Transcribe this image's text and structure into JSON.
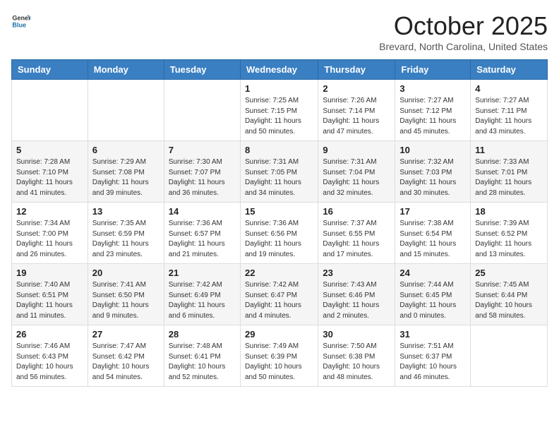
{
  "logo": {
    "general": "General",
    "blue": "Blue"
  },
  "title": "October 2025",
  "location": "Brevard, North Carolina, United States",
  "days_of_week": [
    "Sunday",
    "Monday",
    "Tuesday",
    "Wednesday",
    "Thursday",
    "Friday",
    "Saturday"
  ],
  "weeks": [
    [
      {
        "day": "",
        "info": ""
      },
      {
        "day": "",
        "info": ""
      },
      {
        "day": "",
        "info": ""
      },
      {
        "day": "1",
        "info": "Sunrise: 7:25 AM\nSunset: 7:15 PM\nDaylight: 11 hours\nand 50 minutes."
      },
      {
        "day": "2",
        "info": "Sunrise: 7:26 AM\nSunset: 7:14 PM\nDaylight: 11 hours\nand 47 minutes."
      },
      {
        "day": "3",
        "info": "Sunrise: 7:27 AM\nSunset: 7:12 PM\nDaylight: 11 hours\nand 45 minutes."
      },
      {
        "day": "4",
        "info": "Sunrise: 7:27 AM\nSunset: 7:11 PM\nDaylight: 11 hours\nand 43 minutes."
      }
    ],
    [
      {
        "day": "5",
        "info": "Sunrise: 7:28 AM\nSunset: 7:10 PM\nDaylight: 11 hours\nand 41 minutes."
      },
      {
        "day": "6",
        "info": "Sunrise: 7:29 AM\nSunset: 7:08 PM\nDaylight: 11 hours\nand 39 minutes."
      },
      {
        "day": "7",
        "info": "Sunrise: 7:30 AM\nSunset: 7:07 PM\nDaylight: 11 hours\nand 36 minutes."
      },
      {
        "day": "8",
        "info": "Sunrise: 7:31 AM\nSunset: 7:05 PM\nDaylight: 11 hours\nand 34 minutes."
      },
      {
        "day": "9",
        "info": "Sunrise: 7:31 AM\nSunset: 7:04 PM\nDaylight: 11 hours\nand 32 minutes."
      },
      {
        "day": "10",
        "info": "Sunrise: 7:32 AM\nSunset: 7:03 PM\nDaylight: 11 hours\nand 30 minutes."
      },
      {
        "day": "11",
        "info": "Sunrise: 7:33 AM\nSunset: 7:01 PM\nDaylight: 11 hours\nand 28 minutes."
      }
    ],
    [
      {
        "day": "12",
        "info": "Sunrise: 7:34 AM\nSunset: 7:00 PM\nDaylight: 11 hours\nand 26 minutes."
      },
      {
        "day": "13",
        "info": "Sunrise: 7:35 AM\nSunset: 6:59 PM\nDaylight: 11 hours\nand 23 minutes."
      },
      {
        "day": "14",
        "info": "Sunrise: 7:36 AM\nSunset: 6:57 PM\nDaylight: 11 hours\nand 21 minutes."
      },
      {
        "day": "15",
        "info": "Sunrise: 7:36 AM\nSunset: 6:56 PM\nDaylight: 11 hours\nand 19 minutes."
      },
      {
        "day": "16",
        "info": "Sunrise: 7:37 AM\nSunset: 6:55 PM\nDaylight: 11 hours\nand 17 minutes."
      },
      {
        "day": "17",
        "info": "Sunrise: 7:38 AM\nSunset: 6:54 PM\nDaylight: 11 hours\nand 15 minutes."
      },
      {
        "day": "18",
        "info": "Sunrise: 7:39 AM\nSunset: 6:52 PM\nDaylight: 11 hours\nand 13 minutes."
      }
    ],
    [
      {
        "day": "19",
        "info": "Sunrise: 7:40 AM\nSunset: 6:51 PM\nDaylight: 11 hours\nand 11 minutes."
      },
      {
        "day": "20",
        "info": "Sunrise: 7:41 AM\nSunset: 6:50 PM\nDaylight: 11 hours\nand 9 minutes."
      },
      {
        "day": "21",
        "info": "Sunrise: 7:42 AM\nSunset: 6:49 PM\nDaylight: 11 hours\nand 6 minutes."
      },
      {
        "day": "22",
        "info": "Sunrise: 7:42 AM\nSunset: 6:47 PM\nDaylight: 11 hours\nand 4 minutes."
      },
      {
        "day": "23",
        "info": "Sunrise: 7:43 AM\nSunset: 6:46 PM\nDaylight: 11 hours\nand 2 minutes."
      },
      {
        "day": "24",
        "info": "Sunrise: 7:44 AM\nSunset: 6:45 PM\nDaylight: 11 hours\nand 0 minutes."
      },
      {
        "day": "25",
        "info": "Sunrise: 7:45 AM\nSunset: 6:44 PM\nDaylight: 10 hours\nand 58 minutes."
      }
    ],
    [
      {
        "day": "26",
        "info": "Sunrise: 7:46 AM\nSunset: 6:43 PM\nDaylight: 10 hours\nand 56 minutes."
      },
      {
        "day": "27",
        "info": "Sunrise: 7:47 AM\nSunset: 6:42 PM\nDaylight: 10 hours\nand 54 minutes."
      },
      {
        "day": "28",
        "info": "Sunrise: 7:48 AM\nSunset: 6:41 PM\nDaylight: 10 hours\nand 52 minutes."
      },
      {
        "day": "29",
        "info": "Sunrise: 7:49 AM\nSunset: 6:39 PM\nDaylight: 10 hours\nand 50 minutes."
      },
      {
        "day": "30",
        "info": "Sunrise: 7:50 AM\nSunset: 6:38 PM\nDaylight: 10 hours\nand 48 minutes."
      },
      {
        "day": "31",
        "info": "Sunrise: 7:51 AM\nSunset: 6:37 PM\nDaylight: 10 hours\nand 46 minutes."
      },
      {
        "day": "",
        "info": ""
      }
    ]
  ]
}
